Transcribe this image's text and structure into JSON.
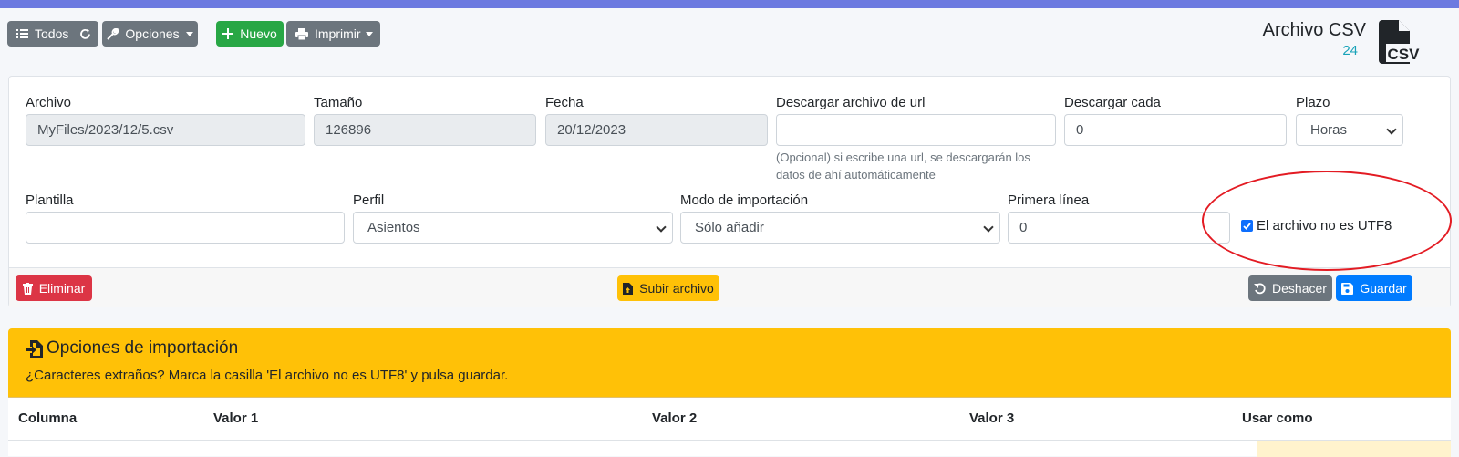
{
  "toolbar": {
    "todos_label": "Todos",
    "opciones_label": "Opciones",
    "nuevo_label": "Nuevo",
    "imprimir_label": "Imprimir"
  },
  "header": {
    "title": "Archivo CSV",
    "count": "24",
    "icon_text": "CSV"
  },
  "form": {
    "archivo": {
      "label": "Archivo",
      "value": "MyFiles/2023/12/5.csv"
    },
    "tamano": {
      "label": "Tamaño",
      "value": "126896"
    },
    "fecha": {
      "label": "Fecha",
      "value": "20/12/2023"
    },
    "url": {
      "label": "Descargar archivo de url",
      "value": "",
      "help_line1": "(Opcional) si escribe una url, se descargarán los",
      "help_line2": "datos de ahí automáticamente"
    },
    "descargar_cada": {
      "label": "Descargar cada",
      "value": "0"
    },
    "plazo": {
      "label": "Plazo",
      "value": "Horas"
    },
    "plantilla": {
      "label": "Plantilla",
      "value": ""
    },
    "perfil": {
      "label": "Perfil",
      "value": "Asientos"
    },
    "modo": {
      "label": "Modo de importación",
      "value": "Sólo añadir"
    },
    "primera_linea": {
      "label": "Primera línea",
      "value": "0"
    },
    "utf8": {
      "label": "El archivo no es UTF8",
      "checked": true
    }
  },
  "footer": {
    "eliminar_label": "Eliminar",
    "subir_label": "Subir archivo",
    "deshacer_label": "Deshacer",
    "guardar_label": "Guardar"
  },
  "import_panel": {
    "title": "Opciones de importación",
    "message": "¿Caracteres extraños? Marca la casilla 'El archivo no es UTF8' y pulsa guardar.",
    "columns": [
      "Columna",
      "Valor 1",
      "Valor 2",
      "Valor 3",
      "Usar como"
    ]
  },
  "colors": {
    "accent_bar": "#6c7ae0",
    "warning": "#ffc107",
    "success": "#28a745",
    "danger": "#dc3545",
    "primary": "#007bff",
    "secondary": "#6c757d",
    "count_color": "#17a2b8",
    "annotation_ellipse": "#e31b23"
  }
}
